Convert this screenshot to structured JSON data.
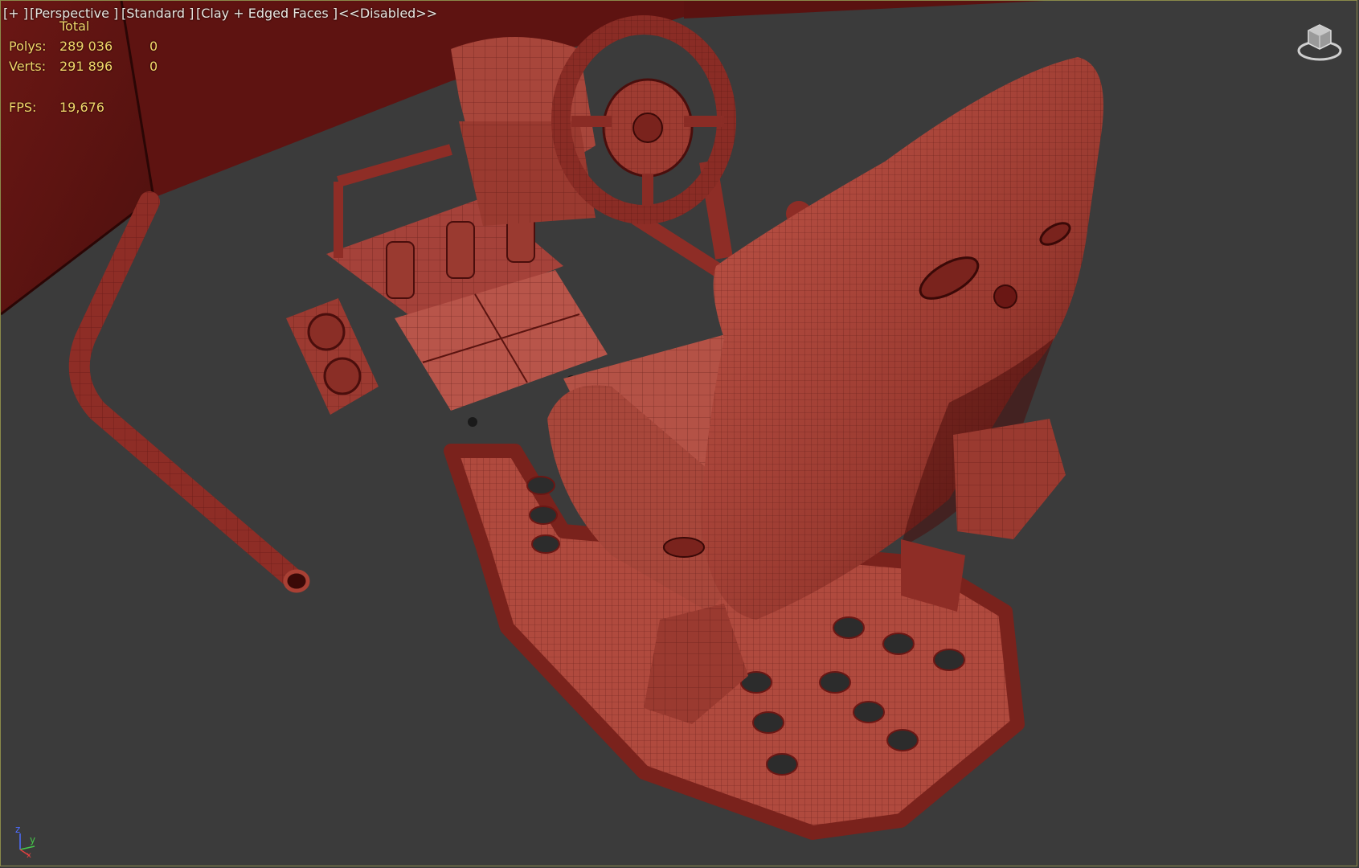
{
  "viewport": {
    "menu": {
      "plus": "[+ ]",
      "view": "[Perspective ]",
      "shading_preset": "[Standard ]",
      "shading_mode": "[Clay + Edged Faces ]",
      "effects": "<<Disabled>>"
    },
    "statistics": {
      "header_total": "Total",
      "polys_label": "Polys:",
      "polys_total": "289 036",
      "polys_selected": "0",
      "verts_label": "Verts:",
      "verts_total": "291 896",
      "verts_selected": "0",
      "fps_label": "FPS:",
      "fps_value": "19,676"
    },
    "axis_labels": {
      "z": "z",
      "y": "y",
      "x": "x"
    },
    "colors": {
      "clay": "#b0473c",
      "clay_dark": "#6a1714",
      "background": "#3b3b3b",
      "stat_text": "#f1d66a",
      "menu_text": "#e9e6e0"
    }
  }
}
